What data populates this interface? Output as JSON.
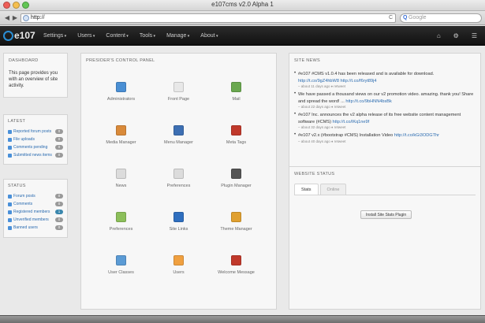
{
  "browser": {
    "window_title": "e107cms v2.0 Alpha 1",
    "url": "http://",
    "search_placeholder": "Google",
    "back": "◀",
    "forward": "▶",
    "reload": "C"
  },
  "navbar": {
    "logo": "e107",
    "menu": [
      "Settings",
      "Users",
      "Content",
      "Tools",
      "Manage",
      "About"
    ],
    "right": [
      "⌂",
      "⚙",
      "☰"
    ]
  },
  "info_panel": {
    "title": "DASHBOARD",
    "text": "This page provides you with an overview of site activity."
  },
  "latest": {
    "title": "LATEST",
    "items": [
      {
        "label": "Reported forum posts",
        "count": "0"
      },
      {
        "label": "File uploads",
        "count": "0"
      },
      {
        "label": "Comments pending",
        "count": "0"
      },
      {
        "label": "Submitted news items",
        "count": "0"
      }
    ]
  },
  "status": {
    "title": "STATUS",
    "items": [
      {
        "label": "Forum posts",
        "count": "0"
      },
      {
        "label": "Comments",
        "count": "0"
      },
      {
        "label": "Registered members",
        "count": "1"
      },
      {
        "label": "Unverified members",
        "count": "0"
      },
      {
        "label": "Banned users",
        "count": "0"
      }
    ]
  },
  "control_panel": {
    "title": "PRESIDER'S CONTROL PANEL",
    "items": [
      {
        "label": "Administrators",
        "icon": "admins-icon",
        "color": "#4a8fd4"
      },
      {
        "label": "Front Page",
        "icon": "front-page-icon",
        "color": "#e8e8e8"
      },
      {
        "label": "Mail",
        "icon": "mail-icon",
        "color": "#6aa84f"
      },
      {
        "label": "Media Manager",
        "icon": "media-manager-icon",
        "color": "#d98a3a"
      },
      {
        "label": "Menu Manager",
        "icon": "menu-manager-icon",
        "color": "#3d6fb3"
      },
      {
        "label": "Meta Tags",
        "icon": "meta-tags-icon",
        "color": "#c0392b"
      },
      {
        "label": "News",
        "icon": "news-icon",
        "color": "#dcdcdc"
      },
      {
        "label": "Preferences",
        "icon": "preferences-icon",
        "color": "#dcdcdc"
      },
      {
        "label": "Plugin Manager",
        "icon": "plugin-manager-icon",
        "color": "#555555"
      },
      {
        "label": "Preferences",
        "icon": "preferences2-icon",
        "color": "#8cbf5a"
      },
      {
        "label": "Site Links",
        "icon": "site-links-icon",
        "color": "#2f6fbf"
      },
      {
        "label": "Theme Manager",
        "icon": "theme-manager-icon",
        "color": "#e0a030"
      },
      {
        "label": "User Classes",
        "icon": "user-classes-icon",
        "color": "#5b9bd5"
      },
      {
        "label": "Users",
        "icon": "users-icon",
        "color": "#f0a040"
      },
      {
        "label": "Welcome Message",
        "icon": "welcome-message-icon",
        "color": "#c0392b"
      }
    ]
  },
  "news": {
    "title": "SITE NEWS",
    "items": [
      {
        "text": "#e107 #CMS v1.0.4 has been released and is available for download.",
        "link": "http://t.co/9gZ4hbW8 http://t.co/f6ryt89j4",
        "meta": "– about 11 days ago  ♦ retweet"
      },
      {
        "text": "We have passed a thousand views on our v2 promotion video. amazing. thank you! Share and spread the word! ...",
        "link": "http://t.co/9bHNN4bsBk",
        "meta": "– about 22 days ago  ♦ retweet"
      },
      {
        "text": "#e107 Inc. announces the v2 alpha release of its free website content management software (#CMS)",
        "link": "http://t.co/lKq1ne9f",
        "meta": "– about 32 days ago  ♦ retweet"
      },
      {
        "text": "#e107 v2.x (#bootstrap #CMS) Installation Video",
        "link": "http://t.co/kGi3ODGThr",
        "meta": "– about 40 days ago  ♦ retweet"
      }
    ]
  },
  "website_status": {
    "title": "WEBSITE STATUS",
    "tabs": [
      "Stats",
      "Online"
    ],
    "button": "Install Site Stats Plugin"
  }
}
